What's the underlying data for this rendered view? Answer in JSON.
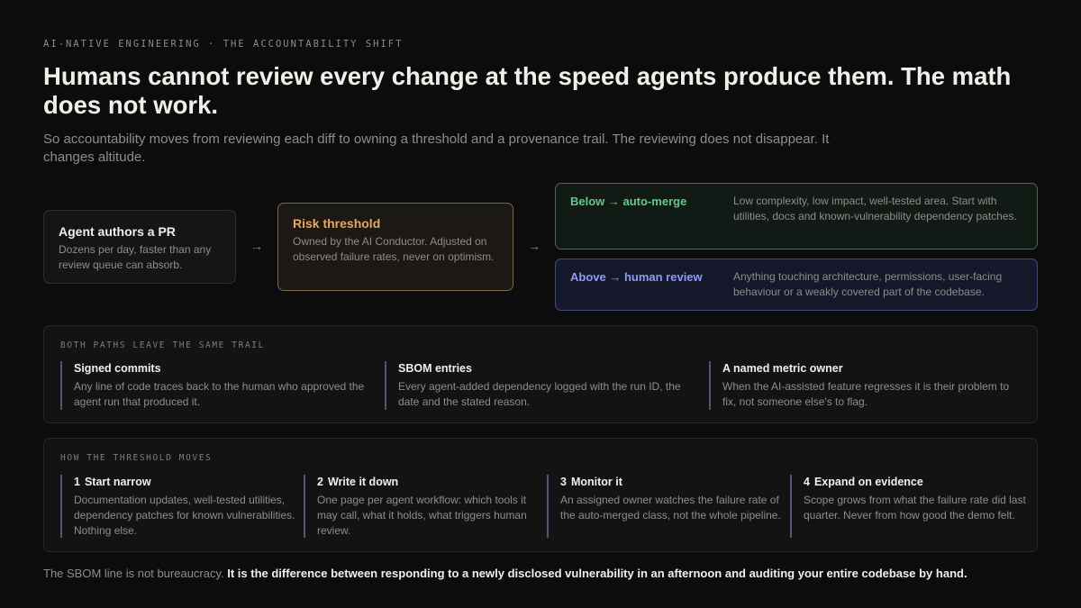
{
  "eyebrow": "AI-NATIVE ENGINEERING · THE ACCOUNTABILITY SHIFT",
  "title": "Humans cannot review every change at the speed agents produce them. The math does not work.",
  "subtitle": "So accountability moves from reviewing each diff to owning a threshold and a provenance trail. The reviewing does not disappear. It changes altitude.",
  "flow": {
    "agent": {
      "title": "Agent authors a PR",
      "body": "Dozens per day, faster than any review queue can absorb."
    },
    "arrow": "→",
    "risk": {
      "title": "Risk threshold",
      "body": "Owned by the AI Conductor. Adjusted on observed failure rates, never on optimism."
    },
    "below": {
      "label": "Below → auto-merge",
      "body": "Low complexity, low impact, well-tested area. Start with utilities, docs and known-vulnerability dependency patches."
    },
    "above": {
      "label": "Above → human review",
      "body": "Anything touching architecture, permissions, user-facing behaviour or a weakly covered part of the codebase."
    }
  },
  "trail": {
    "label": "BOTH PATHS LEAVE THE SAME TRAIL",
    "items": [
      {
        "title": "Signed commits",
        "body": "Any line of code traces back to the human who approved the agent run that produced it."
      },
      {
        "title": "SBOM entries",
        "body": "Every agent-added dependency logged with the run ID, the date and the stated reason."
      },
      {
        "title": "A named metric owner",
        "body": "When the AI-assisted feature regresses it is their problem to fix, not someone else's to flag."
      }
    ]
  },
  "steps": {
    "label": "HOW THE THRESHOLD MOVES",
    "items": [
      {
        "num": "1",
        "title": "Start narrow",
        "body": "Documentation updates, well-tested utilities, dependency patches for known vulnerabilities. Nothing else."
      },
      {
        "num": "2",
        "title": "Write it down",
        "body": "One page per agent workflow: which tools it may call, what it holds, what triggers human review."
      },
      {
        "num": "3",
        "title": "Monitor it",
        "body": "An assigned owner watches the failure rate of the auto-merged class, not the whole pipeline."
      },
      {
        "num": "4",
        "title": "Expand on evidence",
        "body": "Scope grows from what the failure rate did last quarter. Never from how good the demo felt."
      }
    ]
  },
  "footer": {
    "lead": "The SBOM line is not bureaucracy.",
    "emphasis": "It is the difference between responding to a newly disclosed vulnerability in an afternoon and auditing your entire codebase by hand."
  },
  "colors": {
    "background": "#0c0c0c",
    "risk_accent": "#e5a95c",
    "auto_merge_green": "#5fcb8a",
    "human_review_blue": "#8e9bf2",
    "rule_accent": "#50557e"
  }
}
